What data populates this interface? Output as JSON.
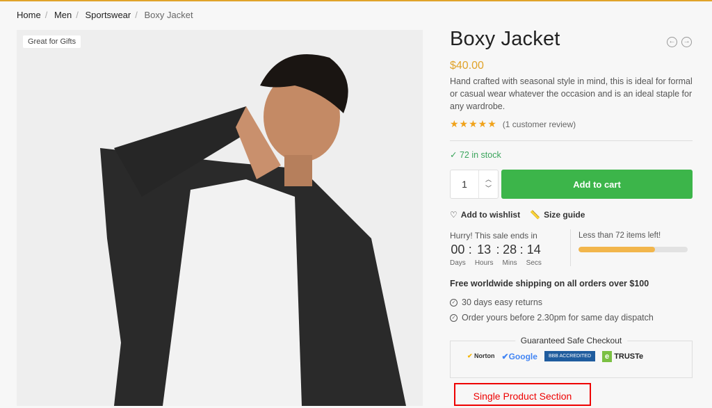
{
  "breadcrumb": [
    "Home",
    "Men",
    "Sportswear",
    "Boxy Jacket"
  ],
  "gallery": {
    "badge": "Great for Gifts"
  },
  "product": {
    "title": "Boxy Jacket",
    "price": "$40.00",
    "description": "Hand crafted with seasonal style in mind, this is ideal for formal or casual wear whatever the occasion and is an ideal staple for any wardrobe.",
    "rating_stars": 5,
    "rating_text": "(1 customer review)",
    "stock": "72 in stock",
    "quantity": "1",
    "add_to_cart": "Add to cart",
    "wishlist": "Add to wishlist",
    "size_guide": "Size guide"
  },
  "sale": {
    "label": "Hurry! This sale ends in",
    "timer": [
      {
        "v": "00",
        "u": "Days"
      },
      {
        "v": "13",
        "u": "Hours"
      },
      {
        "v": "28",
        "u": "Mins"
      },
      {
        "v": "14",
        "u": "Secs"
      }
    ],
    "items_left": "Less than 72 items left!",
    "progress_percent": 70
  },
  "shipping": "Free worldwide shipping on all orders over $100",
  "features": [
    "30 days easy returns",
    "Order yours before 2.30pm for same day dispatch"
  ],
  "safe_checkout": {
    "title": "Guaranteed Safe Checkout",
    "logos": [
      "Norton Secured",
      "Google Trusted Store",
      "BBB Accredited Business",
      "TRUSTe Certified Privacy"
    ]
  },
  "annotation": "Single Product Section",
  "colors": {
    "accent": "#e0a32a",
    "cart": "#3cb54a",
    "stock": "#3ba55c",
    "annotation": "#e00000"
  }
}
